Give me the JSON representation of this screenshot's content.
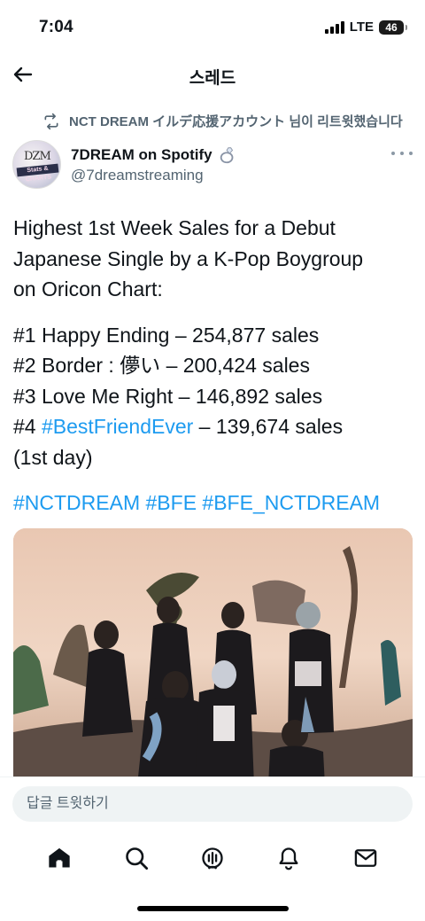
{
  "status_bar": {
    "time": "7:04",
    "network": "LTE",
    "battery": "46"
  },
  "header": {
    "title": "스레드",
    "back_icon": "arrow-left-icon"
  },
  "retweet": {
    "text": "NCT DREAM イルデ応援アカウント 님이 리트윗했습니다",
    "icon": "retweet-icon"
  },
  "author": {
    "name": "7DREAM on Spotify",
    "handle": "@7dreamstreaming",
    "avatar_top": "DZM",
    "avatar_bar": "Stats & CHARTS",
    "badge_icon": "ring-icon"
  },
  "tweet": {
    "intro_lines": [
      "Highest 1st Week Sales for a Debut",
      "Japanese Single by a K-Pop Boygroup",
      "on Oricon Chart:"
    ],
    "rank_lines": [
      "#1 Happy Ending – 254,877 sales",
      "#2 Border : 儚い – 200,424 sales",
      "#3 Love Me Right – 146,892 sales"
    ],
    "rank4_prefix": "#4 ",
    "rank4_hashtag": "#BestFriendEver",
    "rank4_suffix": " – 139,674 sales",
    "rank4_note": "(1st day)",
    "hashtags": "#NCTDREAM #BFE #BFE_NCTDREAM"
  },
  "media": {
    "icon": "photo"
  },
  "reply": {
    "placeholder": "답글 트윗하기"
  },
  "bottom_nav": {
    "items": [
      "home-icon",
      "search-icon",
      "spaces-icon",
      "notifications-icon",
      "messages-icon"
    ]
  },
  "colors": {
    "link": "#1d9bf0",
    "secondary": "#536471",
    "text": "#0f1419"
  }
}
